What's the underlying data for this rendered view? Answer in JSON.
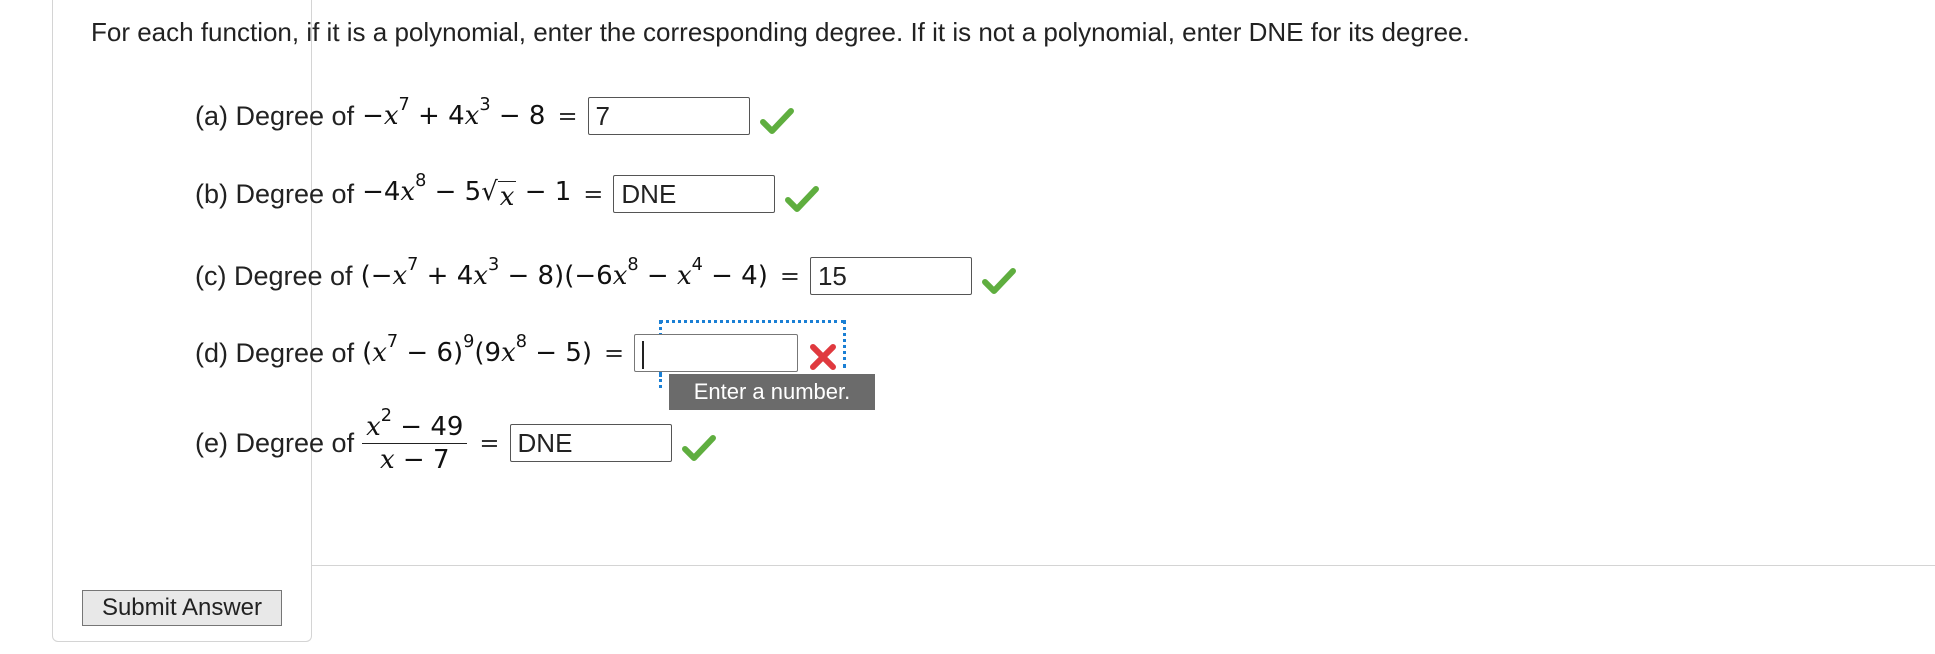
{
  "instructions": "For each function, if it is a polynomial, enter the corresponding degree. If it is not a polynomial, enter DNE for its degree.",
  "questions": [
    {
      "label": "(a) Degree of",
      "answer": "7",
      "status": "correct"
    },
    {
      "label": "(b) Degree of",
      "answer": "DNE",
      "status": "correct"
    },
    {
      "label": "(c) Degree of",
      "answer": "15",
      "status": "correct"
    },
    {
      "label": "(d) Degree of",
      "answer": "",
      "status": "incorrect"
    },
    {
      "label": "(e) Degree of",
      "answer": "DNE",
      "status": "correct"
    }
  ],
  "tooltip": "Enter a number.",
  "submit_label": "Submit Answer",
  "colors": {
    "check": "#5fae3f",
    "cross": "#e0393e",
    "focus": "#1a7fd4",
    "tooltip_bg": "#6b6b6b"
  },
  "icons": {
    "correct": "check-mark-icon",
    "incorrect": "x-mark-icon"
  }
}
